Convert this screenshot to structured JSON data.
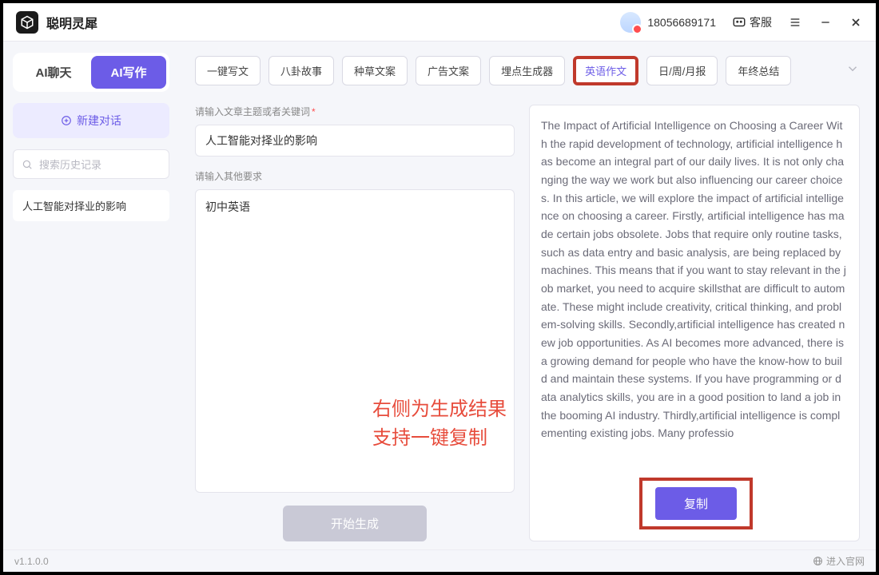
{
  "app": {
    "name": "聪明灵犀"
  },
  "header": {
    "phone": "18056689171",
    "support_label": "客服"
  },
  "sidebar": {
    "tabs": {
      "chat": "AI聊天",
      "write": "AI写作",
      "active": "write"
    },
    "new_chat_label": "新建对话",
    "search_placeholder": "搜索历史记录",
    "history": [
      "人工智能对择业的影响"
    ]
  },
  "categories": {
    "items": [
      "一键写文",
      "八卦故事",
      "种草文案",
      "广告文案",
      "埋点生成器",
      "英语作文",
      "日/周/月报",
      "年终总结"
    ],
    "selected_index": 5
  },
  "form": {
    "topic_label": "请输入文章主题或者关键词",
    "topic_value": "人工智能对择业的影响",
    "extra_label": "请输入其他要求",
    "extra_value": "初中英语",
    "generate_label": "开始生成"
  },
  "result": {
    "copy_label": "复制",
    "text": "The Impact of Artificial Intelligence on Choosing a Career With the rapid development of technology, artificial intelligence has become an integral part of our daily lives. It is not only changing the way we work but also influencing our career choices. In this article, we will explore the impact of artificial intelligence on choosing a career. Firstly, artificial intelligence has made certain jobs obsolete. Jobs that require only routine tasks, such as data entry and basic analysis, are being replaced by machines. This means that if you want to stay relevant in the job market, you need to acquire skillsthat are difficult to automate. These might include creativity, critical thinking, and problem-solving skills. Secondly,artificial intelligence has created new job opportunities. As AI becomes more advanced, there is a growing demand for people who have the know-how to build and maintain these systems. If you have programming or data analytics skills, you are in a good position to land a job in the booming AI industry. Thirdly,artificial intelligence is complementing existing jobs. Many professio"
  },
  "annotation": {
    "line1": "右侧为生成结果",
    "line2": "支持一键复制"
  },
  "status": {
    "version": "v1.1.0.0",
    "official_site": "进入官网"
  }
}
